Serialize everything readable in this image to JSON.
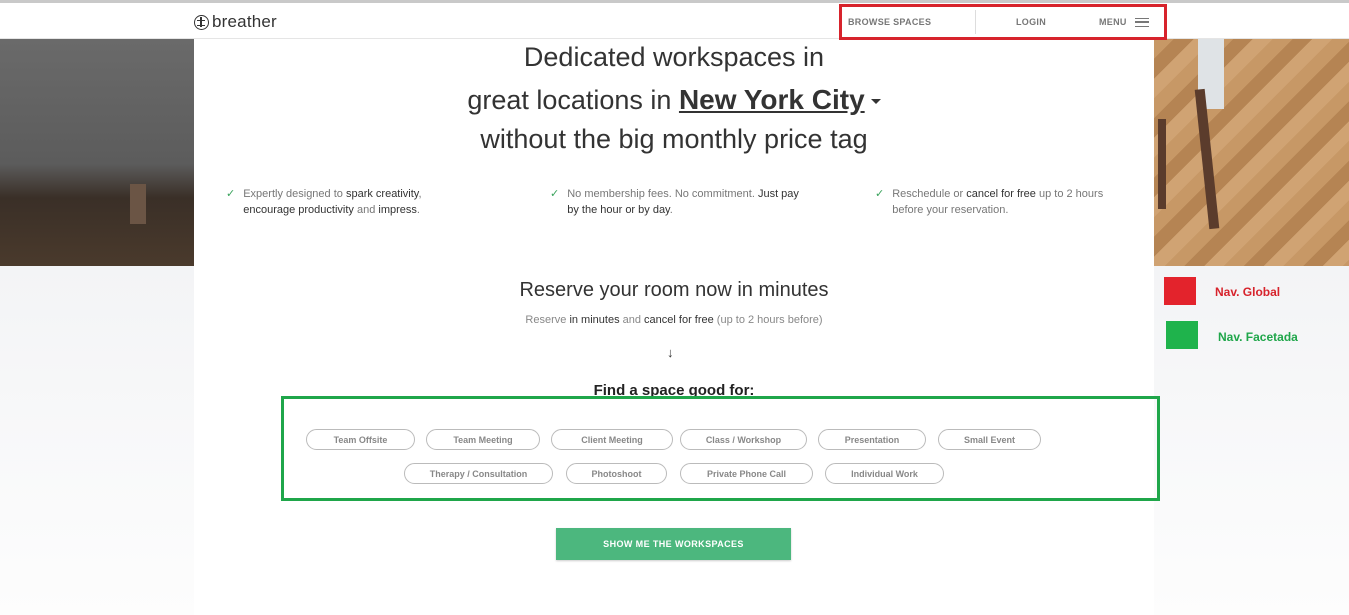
{
  "header": {
    "logo_text": "breather",
    "nav": {
      "browse_label": "BROWSE SPACES",
      "login_label": "LOGIN",
      "menu_label": "MENU"
    }
  },
  "hero": {
    "line1": "Dedicated workspaces in",
    "line2_prefix": "great locations in ",
    "city": "New York City",
    "line3": "without the big monthly price tag"
  },
  "features": [
    {
      "parts": [
        "Expertly designed to ",
        "spark creativity",
        ", ",
        "encourage productivity",
        " and ",
        "impress",
        "."
      ]
    },
    {
      "parts": [
        "No membership fees. No commitment. ",
        "Just pay by the hour or by day",
        "."
      ]
    },
    {
      "parts": [
        "Reschedule or ",
        "cancel for free",
        " up to 2 hours before your reservation."
      ]
    }
  ],
  "reserve": {
    "title": "Reserve your room now in minutes",
    "sub_a": "Reserve ",
    "sub_b": "in minutes",
    "sub_c": " and ",
    "sub_d": "cancel for free",
    "sub_e": " (up to 2 hours before)",
    "arrow": "↓"
  },
  "find": {
    "title": "Find a space good for:",
    "chips_row1": [
      "Team Offsite",
      "Team Meeting",
      "Client Meeting",
      "Class / Workshop",
      "Presentation",
      "Small Event"
    ],
    "chips_row2": [
      "Therapy / Consultation",
      "Photoshoot",
      "Private Phone Call",
      "Individual Work"
    ]
  },
  "cta_label": "SHOW ME THE WORKSPACES",
  "legend": {
    "global_label": "Nav. Global",
    "global_color": "#e3232c",
    "faceted_label": "Nav. Facetada",
    "faceted_color": "#1fb34c"
  }
}
